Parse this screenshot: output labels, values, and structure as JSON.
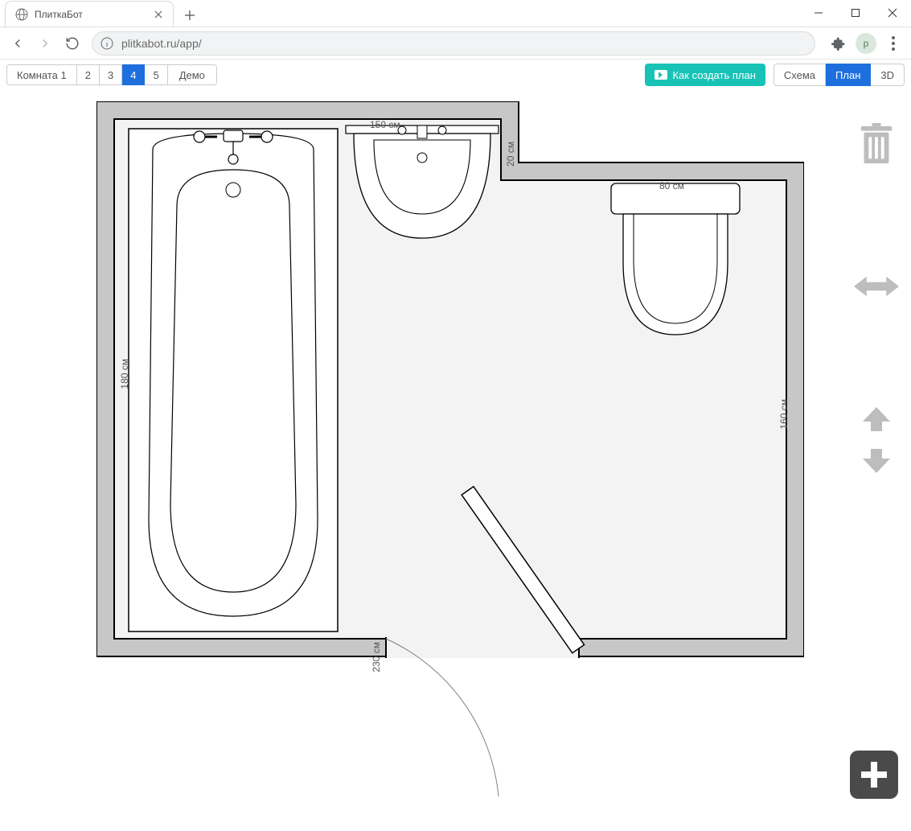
{
  "window": {
    "tab_title": "ПлиткаБот",
    "url_display": "plitkabot.ru/app/",
    "avatar_initial": "р"
  },
  "app": {
    "room_tabs": {
      "label_first": "Комната 1",
      "t2": "2",
      "t3": "3",
      "t4": "4",
      "t5": "5",
      "demo": "Демо",
      "active_index": 3
    },
    "howto_label": "Как создать план",
    "view_toggle": {
      "schema": "Схема",
      "plan": "План",
      "three_d": "3D",
      "active": "plan"
    }
  },
  "plan": {
    "dims": {
      "top_width": "150 см",
      "notch_height": "20 см",
      "notch_width": "80 см",
      "right_height": "160 см",
      "left_height": "180 см",
      "bottom_width": "230 см"
    },
    "fixtures": {
      "bathtub": "bathtub",
      "sink": "sink",
      "toilet": "toilet",
      "door": "door"
    }
  },
  "tools": {
    "trash": "trash-icon",
    "hresize": "horizontal-resize-icon",
    "up": "arrow-up-icon",
    "down": "arrow-down-icon",
    "add": "add-icon"
  }
}
